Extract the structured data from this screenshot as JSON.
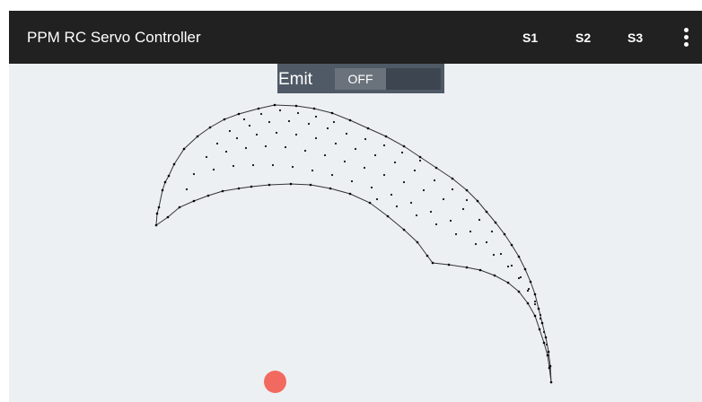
{
  "app": {
    "title": "PPM RC Servo Controller",
    "actions": [
      "S1",
      "S2",
      "S3"
    ],
    "overflow_icon": "more-vert-icon"
  },
  "emit": {
    "label": "Emit",
    "toggle_state": "OFF"
  },
  "colors": {
    "appbar": "#212121",
    "canvas_background": "#edf0f3",
    "panel": "#4f5a66",
    "touch_dot": "#f26a5f"
  }
}
